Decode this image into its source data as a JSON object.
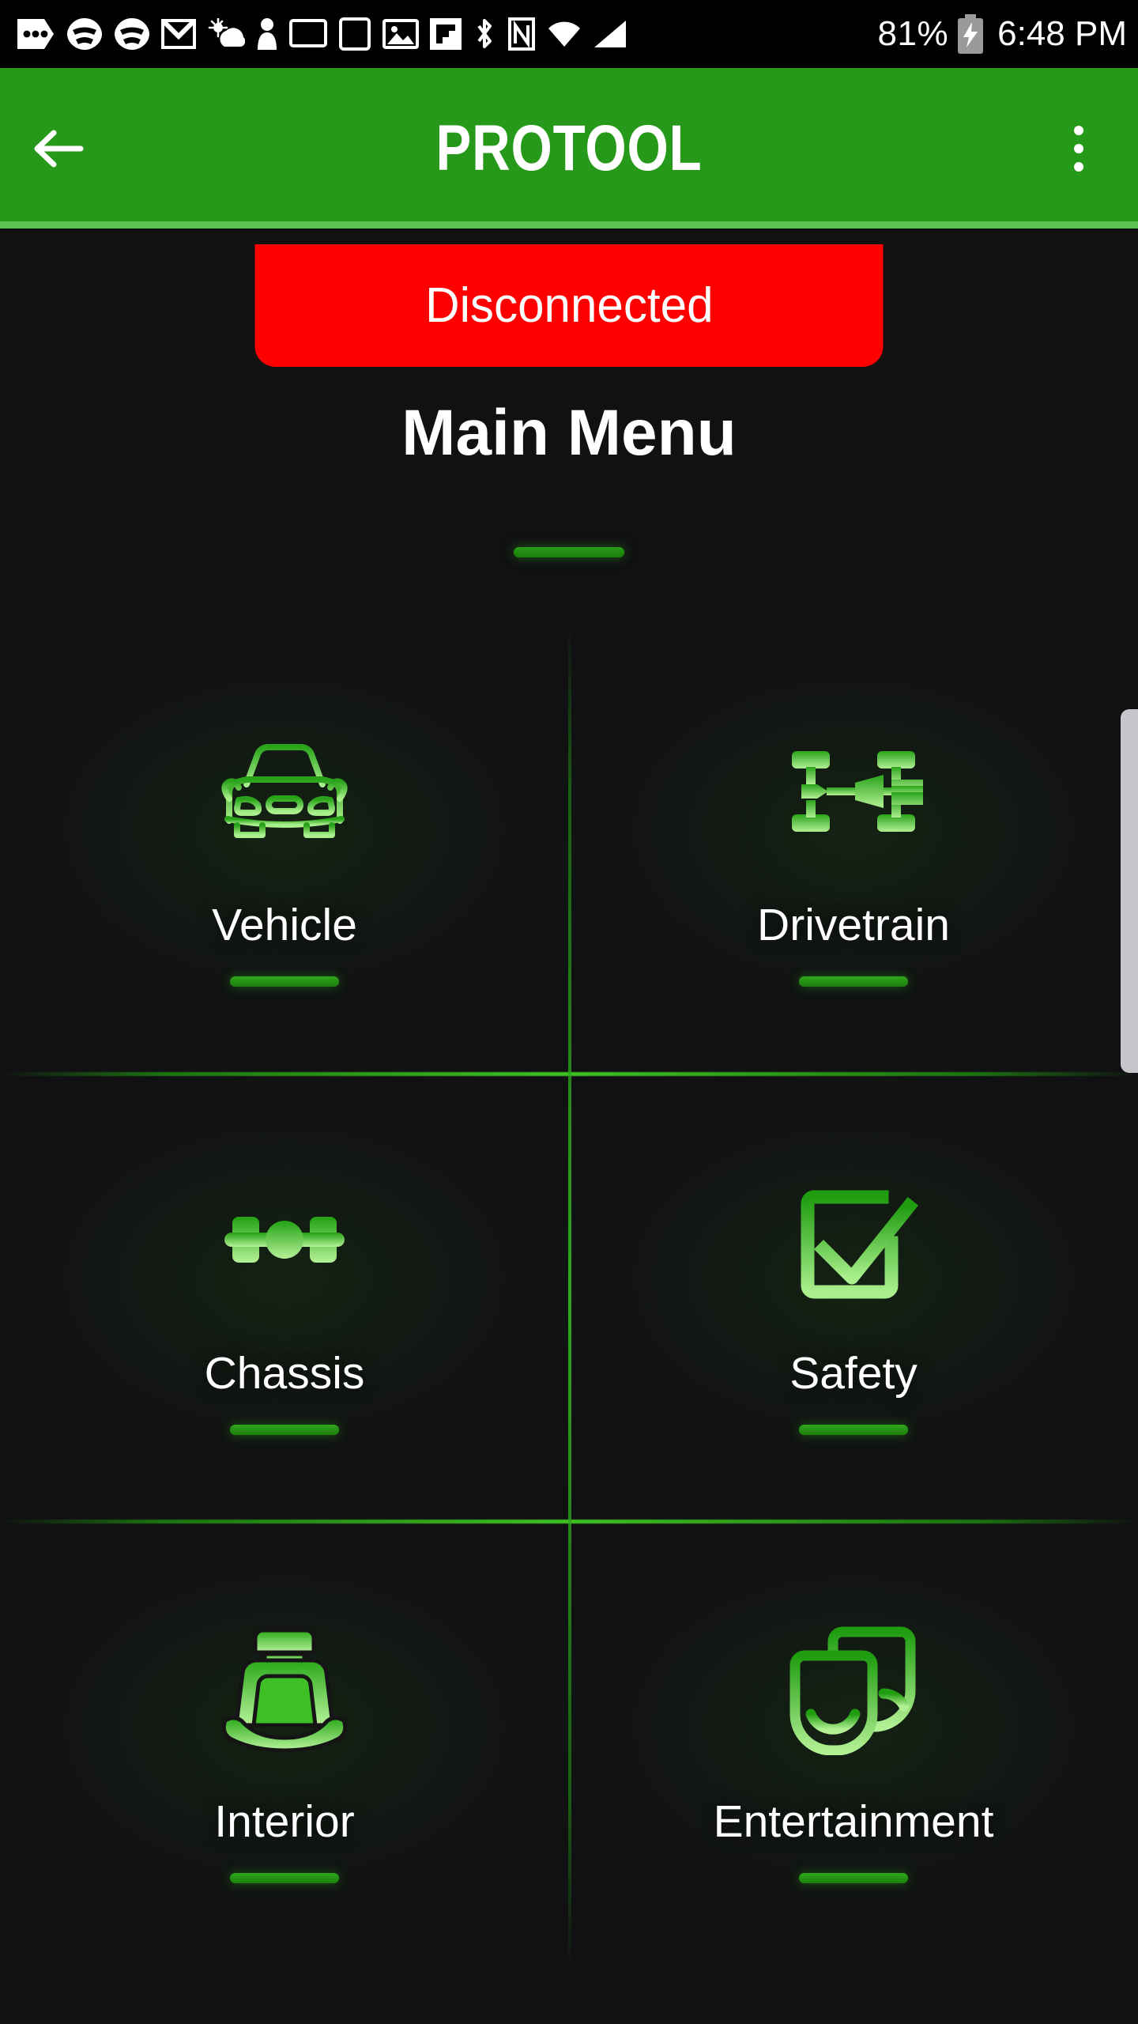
{
  "statusbar": {
    "icons_left": [
      "more-messages-icon",
      "wifi-icon",
      "wifi-icon-2",
      "gmail-icon",
      "weather-icon",
      "person-icon",
      "monitor-icon",
      "monitor-icon-2",
      "photo-icon",
      "flipboard-icon",
      "bluetooth-icon",
      "nfc-icon",
      "wifi-signal-icon",
      "cell-signal-icon"
    ],
    "battery_percent": "81%",
    "battery_icon": "battery-charging-icon",
    "time": "6:48 PM"
  },
  "appbar": {
    "back_icon": "back-arrow-icon",
    "title": "PROTOOL",
    "overflow_icon": "overflow-menu-icon",
    "bg_color": "#27991a",
    "underline_color": "#5cc24f"
  },
  "status": {
    "label": "Disconnected",
    "color": "#ff0000"
  },
  "page": {
    "title": "Main Menu"
  },
  "menu": {
    "items": [
      {
        "label": "Vehicle",
        "icon": "car-front-icon"
      },
      {
        "label": "Drivetrain",
        "icon": "drivetrain-icon"
      },
      {
        "label": "Chassis",
        "icon": "axle-icon"
      },
      {
        "label": "Safety",
        "icon": "checkbox-check-icon"
      },
      {
        "label": "Interior",
        "icon": "car-seat-icon"
      },
      {
        "label": "Entertainment",
        "icon": "theater-masks-icon"
      }
    ],
    "accent_color": "#2fa81c"
  }
}
